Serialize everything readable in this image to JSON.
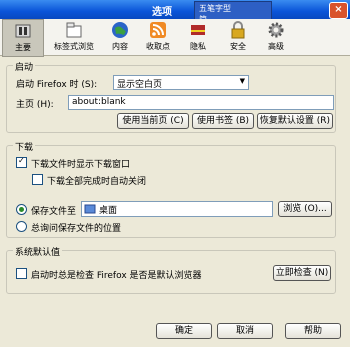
{
  "window": {
    "title": "选项",
    "close_glyph": "×"
  },
  "ime": {
    "line1": "五笔字型",
    "line2": "简"
  },
  "toolbar": [
    {
      "label": "主要",
      "icon": "main-switch-icon"
    },
    {
      "label": "标签式浏览",
      "icon": "tabs-icon"
    },
    {
      "label": "内容",
      "icon": "globe-icon"
    },
    {
      "label": "收取点",
      "icon": "feed-icon"
    },
    {
      "label": "隐私",
      "icon": "privacy-icon"
    },
    {
      "label": "安全",
      "icon": "lock-icon"
    },
    {
      "label": "高级",
      "icon": "gear-icon"
    }
  ],
  "startup": {
    "legend": "启动",
    "when_label": "启动 Firefox 时 (S):",
    "when_value": "显示空白页",
    "home_label": "主页 (H):",
    "home_value": "about:blank",
    "btn_current": "使用当前页 (C)",
    "btn_bookmark": "使用书签 (B)",
    "btn_restore": "恢复默认设置 (R)"
  },
  "downloads": {
    "legend": "下载",
    "show_window": "下载文件时显示下载窗口",
    "close_when_done": "下载全部完成时自动关闭",
    "save_to": "保存文件至",
    "folder": "桌面",
    "browse": "浏览 (O)...",
    "always_ask": "总询问保存文件的位置"
  },
  "defaults": {
    "legend": "系统默认值",
    "check_label": "启动时总是检查 Firefox 是否是默认浏览器",
    "check_now": "立即检查 (N)"
  },
  "footer": {
    "ok": "确定",
    "cancel": "取消",
    "help": "帮助"
  },
  "colors": {
    "titlebar": "#0a54d8",
    "dialog_bg": "#ece9d8"
  }
}
